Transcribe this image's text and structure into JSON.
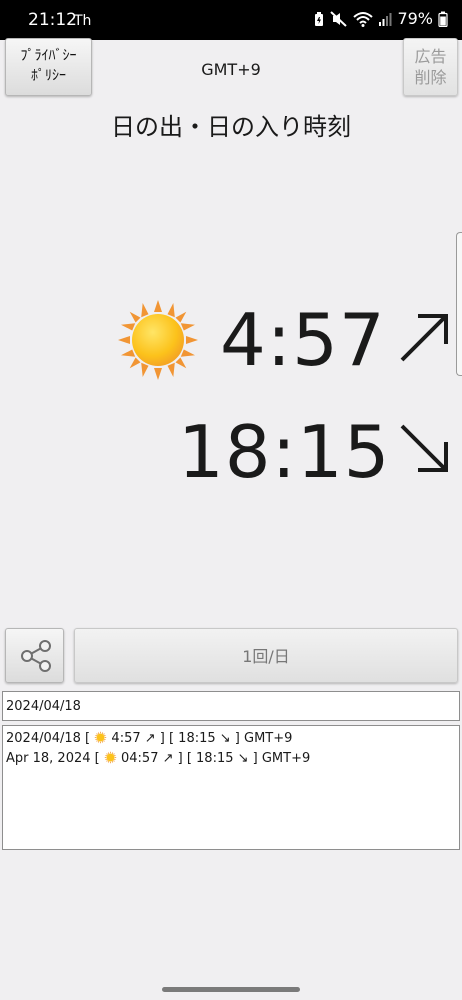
{
  "status_bar": {
    "time": "21:12",
    "day": "Th",
    "battery": "79%"
  },
  "header": {
    "privacy_label_line1": "ﾌﾟﾗｲﾊﾞｼｰ",
    "privacy_label_line2": "ﾎﾟﾘｼｰ",
    "timezone": "GMT+9",
    "ad_label_line1": "広告",
    "ad_label_line2": "削除",
    "title": "日の出・日の入り時刻"
  },
  "main": {
    "sun_icon": "sun-icon",
    "sunrise_time": "4:57",
    "sunset_time": "18:15",
    "sunrise_arrow": "north-east-arrow-icon",
    "sunset_arrow": "south-east-arrow-icon"
  },
  "controls": {
    "share_icon": "share-icon",
    "frequency_label": "1回/日"
  },
  "date_field": {
    "value": "2024/04/18"
  },
  "results": {
    "line1": {
      "prefix": "2024/04/18 [",
      "suffix": "4:57 ↗ ] [ 18:15 ↘ ] GMT+9"
    },
    "line2": {
      "prefix": "Apr 18, 2024 [",
      "suffix": "04:57 ↗ ] [ 18:15 ↘ ] GMT+9"
    }
  },
  "colors": {
    "background": "#f0eff1",
    "status_bar": "#000000",
    "sun_yellow": "#fcc21b",
    "sun_orange": "#f19534"
  }
}
